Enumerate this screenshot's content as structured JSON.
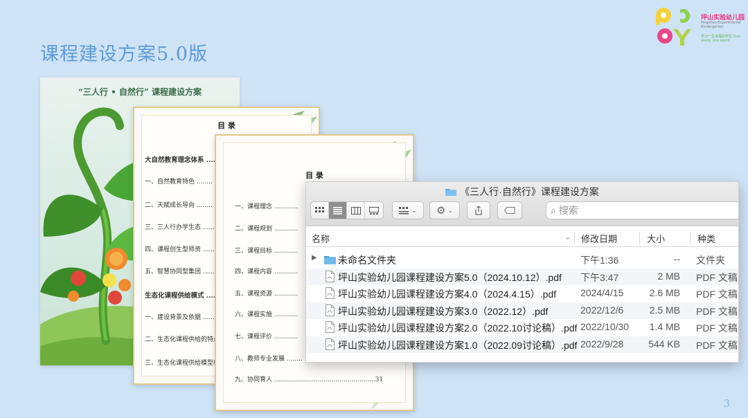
{
  "slide": {
    "title": "课程建设方案5.0版",
    "page_number": "3"
  },
  "logo": {
    "letters": "PGSY",
    "name": "坪山实验幼儿园",
    "subtitle": "Pingshan Experimental Kindergarten",
    "tagline": "学习一生幸福的学生 One world, one world"
  },
  "cover": {
    "title": "“三人行 • 自然行” 课程建设方案"
  },
  "toc1": {
    "heading": "目  录",
    "lines": [
      "大自然教育理念体系 ......",
      "一、自然教育特色 ........",
      "二、天赋成长导向 ........",
      "三、三人行办学生态 ......",
      "四、课程创生型师资 ......",
      "五、智慧协同型集团 ......",
      "生态化课程供给模式 ......",
      "一、建设背景及依据 ......",
      "二、生态化课程供给的特点 .",
      "三、生态化课程供给模型构建"
    ]
  },
  "toc2": {
    "heading": "目  录",
    "lines": [
      "一、课程理念 ............",
      "二、课程规划 ............",
      "三、课程目标 ............",
      "四、课程内容 ............",
      "五、课程资源 ............",
      "六、课程实施 ............",
      "七、课程评价 ............",
      "八、教师专业发展 ........",
      "九、协同育人 ...................................................31"
    ]
  },
  "finder": {
    "window_title": "《三人行·自然行》课程建设方案",
    "search_placeholder": "搜索",
    "columns": {
      "name": "名称",
      "date": "修改日期",
      "size": "大小",
      "kind": "种类"
    },
    "rows": [
      {
        "type": "folder",
        "name": "未命名文件夹",
        "date": "下午1:36",
        "size": "--",
        "kind": "文件夹"
      },
      {
        "type": "pdf",
        "name": "坪山实验幼儿园课程建设方案5.0（2024.10.12）.pdf",
        "date": "下午3:47",
        "size": "2 MB",
        "kind": "PDF 文稿"
      },
      {
        "type": "pdf",
        "name": "坪山实验幼儿园课程建设方案4.0（2024.4.15）.pdf",
        "date": "2024/4/15",
        "size": "2.6 MB",
        "kind": "PDF 文稿"
      },
      {
        "type": "pdf",
        "name": "坪山实验幼儿园课程建设方案3.0（2022.12）.pdf",
        "date": "2022/12/6",
        "size": "2.5 MB",
        "kind": "PDF 文稿"
      },
      {
        "type": "pdf",
        "name": "坪山实验幼儿园课程建设方案2.0（2022.10讨论稿）.pdf",
        "date": "2022/10/30",
        "size": "1.4 MB",
        "kind": "PDF 文稿"
      },
      {
        "type": "pdf",
        "name": "坪山实验幼儿园课程建设方案1.0（2022.09讨论稿）.pdf",
        "date": "2022/9/28",
        "size": "544 KB",
        "kind": "PDF 文稿"
      }
    ]
  },
  "colors": {
    "background": "#cfe3f7",
    "title": "#5d9bd9",
    "folder_blue": "#5aaae6",
    "doc_border": "#e3c98a"
  },
  "icons": [
    "icon-view-icon",
    "list-view-icon",
    "column-view-icon",
    "gallery-view-icon",
    "group-icon",
    "gear-icon",
    "share-icon",
    "tag-icon",
    "search-icon",
    "folder-icon",
    "pdf-file-icon",
    "disclosure-triangle-icon"
  ]
}
